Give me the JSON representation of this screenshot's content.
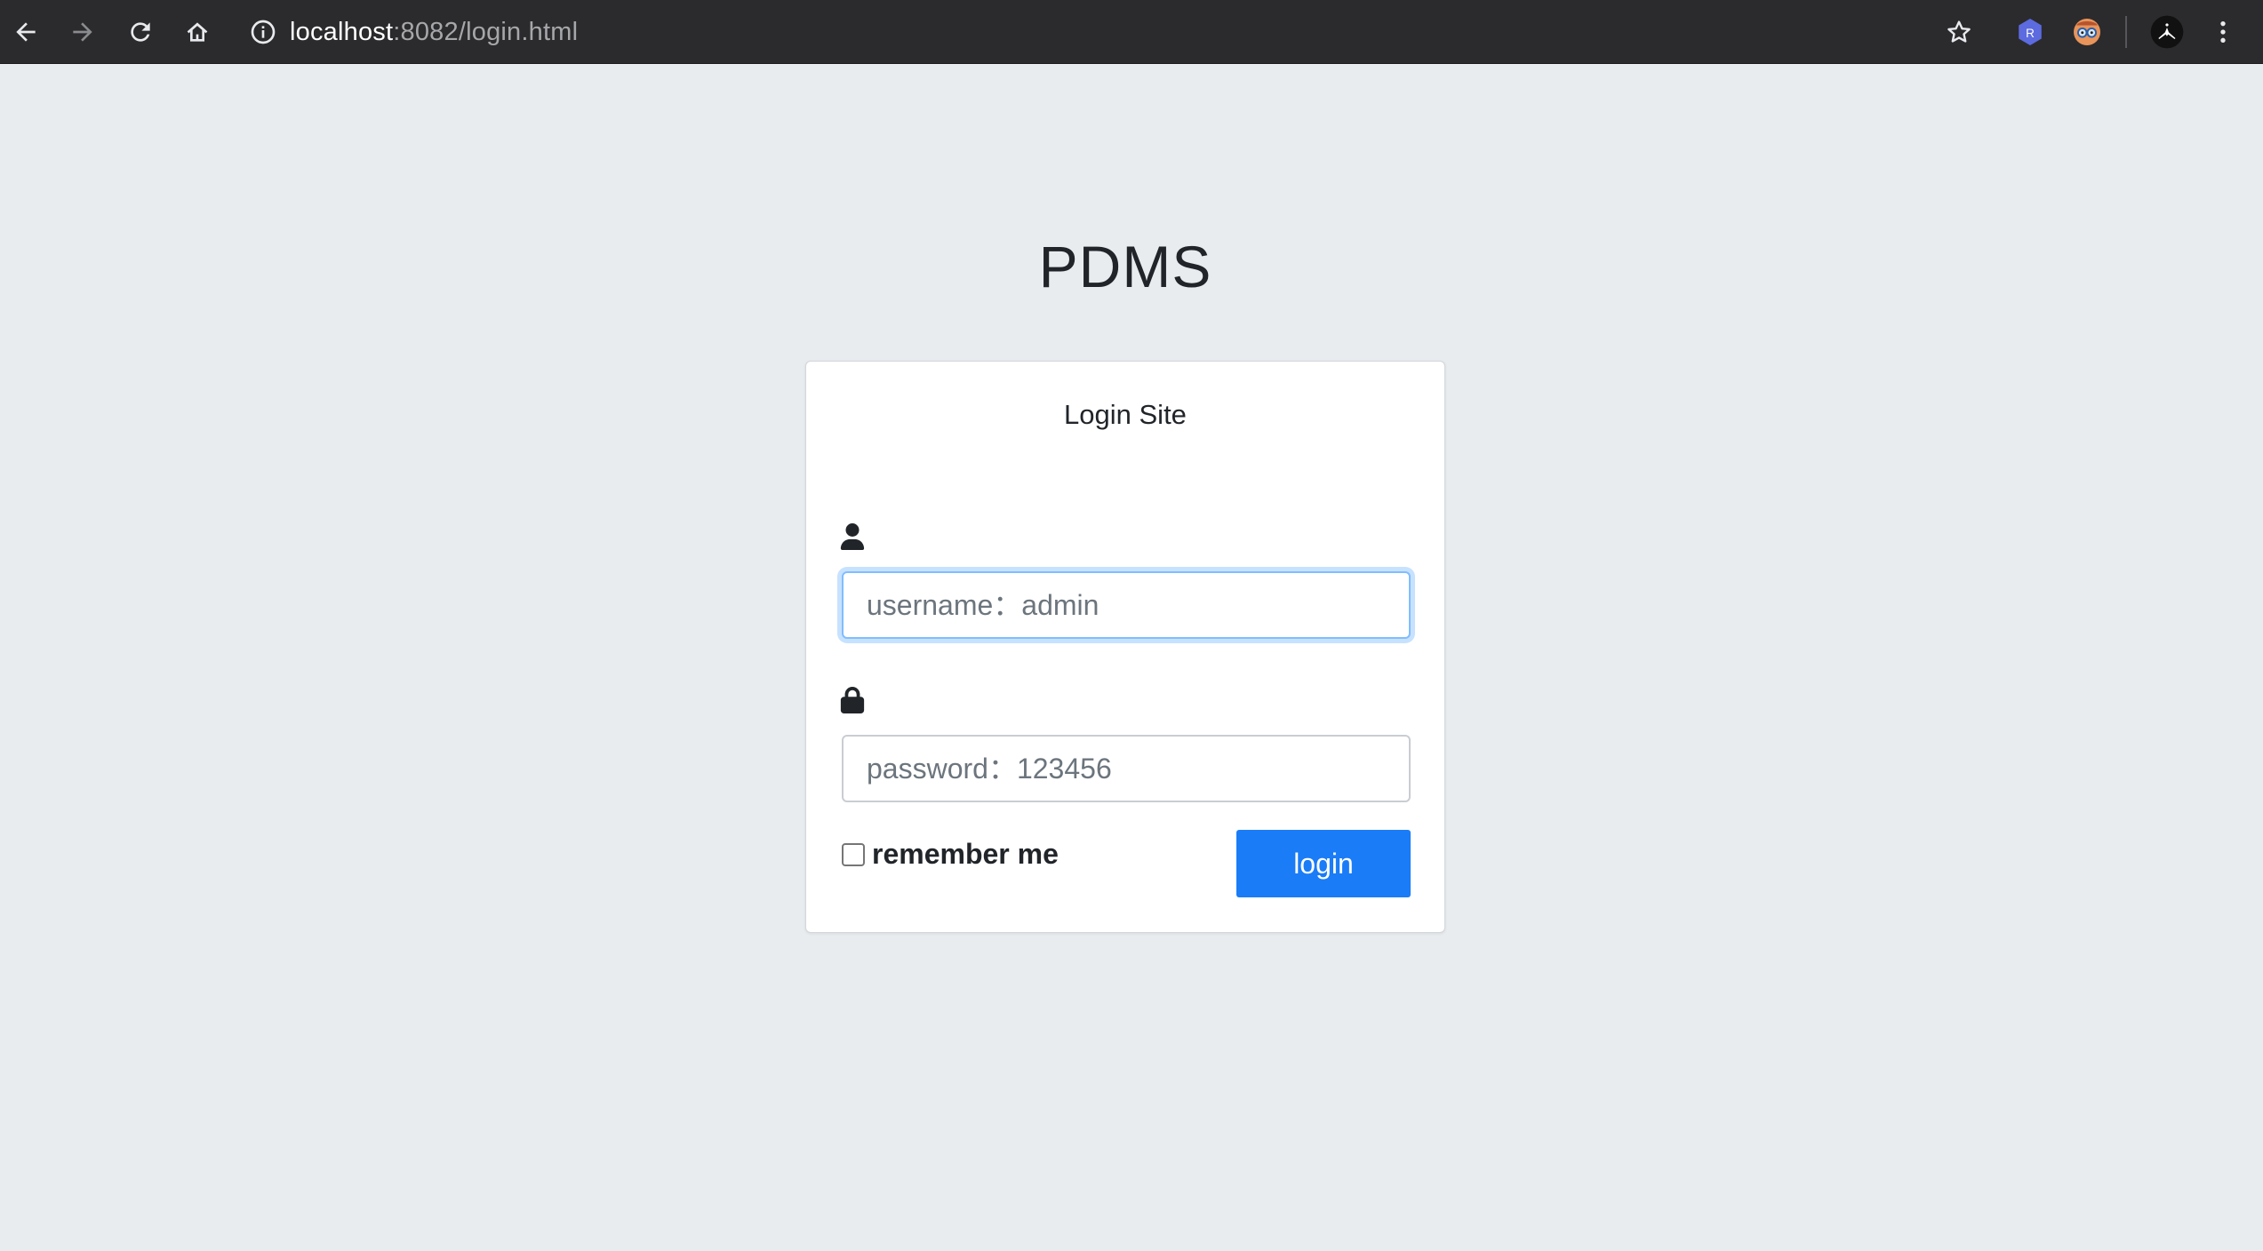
{
  "browser": {
    "url_host": "localhost",
    "url_rest": ":8082/login.html",
    "icons": [
      "back-icon",
      "forward-icon",
      "reload-icon",
      "home-icon",
      "site-info-icon",
      "bookmark-star-icon",
      "extension-r-icon",
      "extension-glasses-icon",
      "profile-avatar-icon",
      "kebab-menu-icon"
    ],
    "extension_r_letter": "R"
  },
  "page": {
    "title": "PDMS"
  },
  "login_card": {
    "heading": "Login Site",
    "username_placeholder": "username：admin",
    "password_placeholder": "password：123456",
    "remember_label": "remember me",
    "remember_checked": false,
    "login_label": "login"
  },
  "colors": {
    "page_bg": "#e9ecef",
    "chrome_bg": "#2b2b2d",
    "primary_button": "#1a7cf7",
    "focus_border": "#80bdff"
  }
}
